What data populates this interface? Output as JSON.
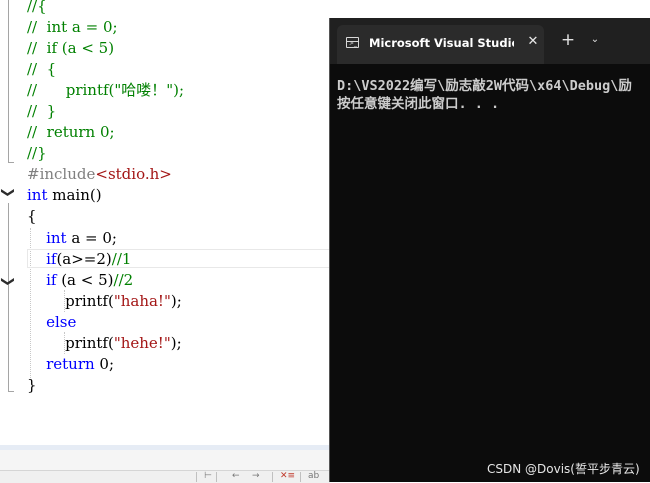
{
  "editor": {
    "lines": [
      "//{",
      "//  int a = 0;",
      "//  if (a < 5)",
      "//  {",
      "//      printf(\"哈喽！\");",
      "//  }",
      "//  return 0;",
      "//}",
      "#include<stdio.h>",
      "int main()",
      "{",
      "    int a = 0;",
      "    if(a>=2)//1",
      "    if (a < 5)//2",
      "        printf(\"haha!\");",
      "    else",
      "        printf(\"hehe!\");",
      "    return 0;",
      "}"
    ],
    "fold_arrow": "❯"
  },
  "console": {
    "tab_title": "Microsoft Visual Studio 调试控制台",
    "close_symbol": "✕",
    "new_tab_symbol": "+",
    "dropdown_symbol": "⌄",
    "output": [
      "D:\\VS2022编写\\励志敲2W代码\\x64\\Debug\\励",
      "按任意键关闭此窗口. . ."
    ]
  },
  "watermark": "CSDN @Dovis(誓平步青云)",
  "toolbar": {
    "icons": [
      "⊢",
      "←",
      "→",
      "✕≡",
      "ab"
    ]
  }
}
